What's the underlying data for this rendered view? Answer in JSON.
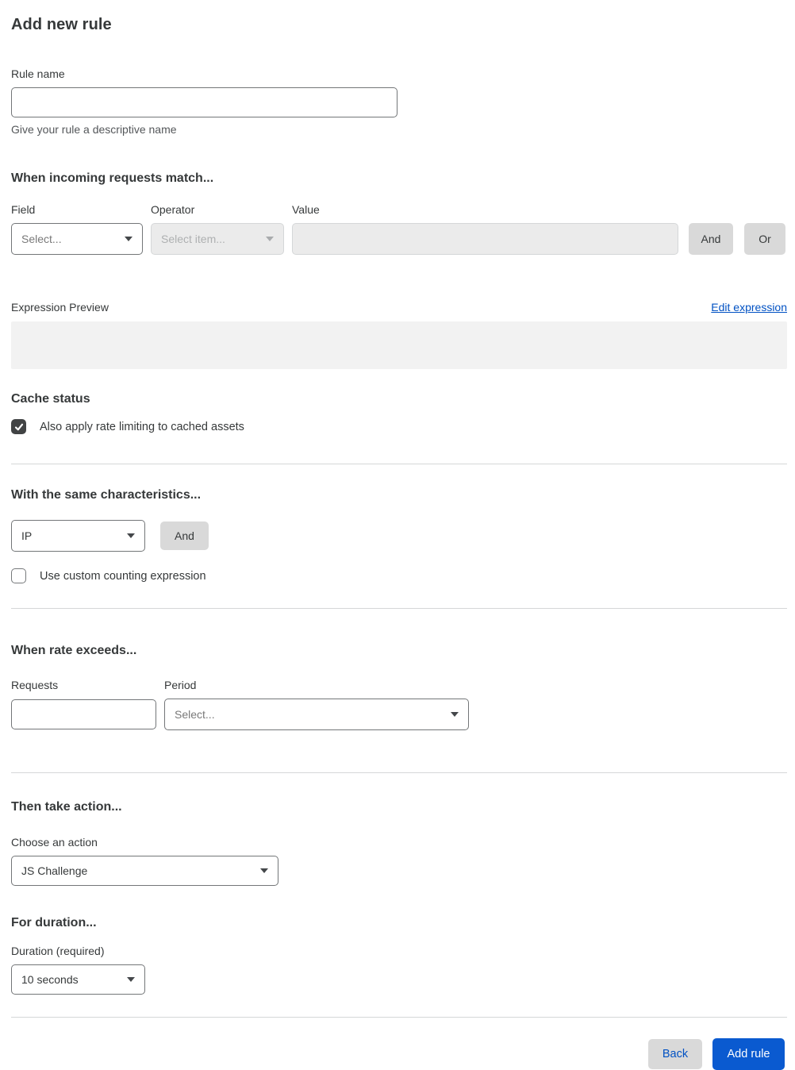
{
  "page": {
    "title": "Add new rule"
  },
  "rule_name": {
    "label": "Rule name",
    "value": "",
    "help": "Give your rule a descriptive name"
  },
  "match": {
    "heading": "When incoming requests match...",
    "field": {
      "label": "Field",
      "placeholder": "Select..."
    },
    "operator": {
      "label": "Operator",
      "placeholder": "Select item..."
    },
    "value": {
      "label": "Value",
      "value": ""
    },
    "and_label": "And",
    "or_label": "Or"
  },
  "expression": {
    "label": "Expression Preview",
    "edit_link": "Edit expression",
    "value": ""
  },
  "cache": {
    "heading": "Cache status",
    "checkbox_label": "Also apply rate limiting to cached assets",
    "checked": true
  },
  "characteristics": {
    "heading": "With the same characteristics...",
    "selected": "IP",
    "and_label": "And",
    "checkbox_label": "Use custom counting expression",
    "checked": false
  },
  "rate": {
    "heading": "When rate exceeds...",
    "requests_label": "Requests",
    "requests_value": "",
    "period_label": "Period",
    "period_placeholder": "Select..."
  },
  "action": {
    "heading": "Then take action...",
    "label": "Choose an action",
    "selected": "JS Challenge"
  },
  "duration": {
    "heading": "For duration...",
    "label": "Duration (required)",
    "selected": "10 seconds"
  },
  "footer": {
    "back_label": "Back",
    "submit_label": "Add rule"
  },
  "colors": {
    "link_blue": "#0051c3",
    "primary_blue": "#0a5ad0",
    "checked_checkbox": "#414344",
    "disabled_bg": "#ebebeb",
    "button_gray": "#d9d9d9",
    "preview_bg": "#f2f2f2"
  }
}
